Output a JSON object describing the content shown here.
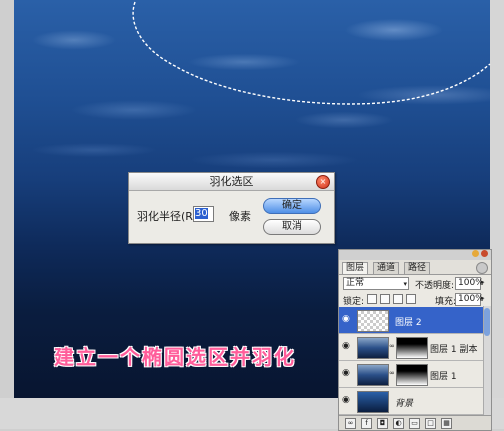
{
  "caption": "建立一个椭圆选区并羽化",
  "dialog": {
    "title": "羽化选区",
    "radius_label": "羽化半径(R):",
    "radius_value": "30",
    "unit": "像素",
    "ok_label": "确定",
    "cancel_label": "取消"
  },
  "layers_panel": {
    "tabs": [
      "图层",
      "通道",
      "路径"
    ],
    "blend_mode": "正常",
    "opacity_label": "不透明度:",
    "opacity_value": "100%",
    "lock_label": "锁定:",
    "fill_label": "填充:",
    "fill_value": "100%",
    "layers": [
      {
        "name": "图层 2",
        "selected": true
      },
      {
        "name": "图层 1 副本",
        "selected": false
      },
      {
        "name": "图层 1",
        "selected": false
      },
      {
        "name": "背景",
        "selected": false
      }
    ]
  },
  "colors": {
    "selection_highlight": "#3563c9",
    "caption_color": "#ff5d9a",
    "ok_button": "#4f8fe6"
  }
}
